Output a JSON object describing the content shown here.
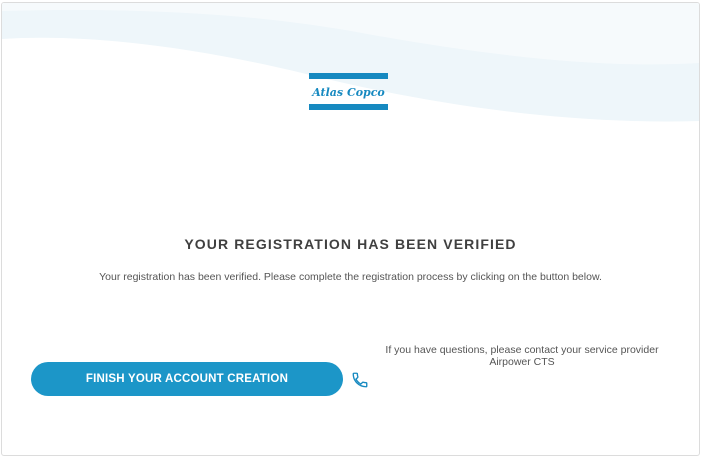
{
  "brand": {
    "logo_text": "Atlas Copco",
    "color": "#1689c0"
  },
  "main": {
    "title": "YOUR REGISTRATION HAS BEEN VERIFIED",
    "message": "Your registration has been verified. Please complete the registration process by clicking on the button below."
  },
  "actions": {
    "finish_label": "FINISH YOUR ACCOUNT CREATION",
    "button_color": "#1c96c8"
  },
  "contact": {
    "line1": "If you have questions, please contact your service provider",
    "line2": "Airpower CTS",
    "icon": "phone-icon"
  }
}
